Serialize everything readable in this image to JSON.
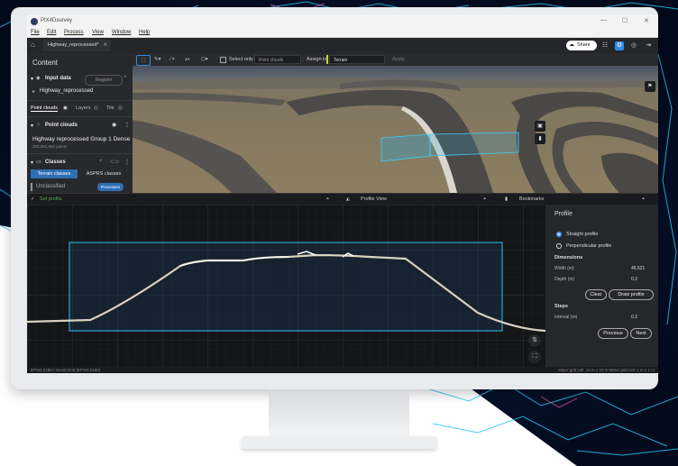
{
  "window": {
    "title": "PIX4Dsurvey",
    "minimize": "—",
    "maximize": "☐",
    "close": "✕"
  },
  "menu": [
    "File",
    "Edit",
    "Process",
    "View",
    "Window",
    "Help"
  ],
  "tabs": {
    "home_icon": "home-icon",
    "document": "Highway_reprocessed*",
    "close": "✕"
  },
  "header": {
    "share": "Share"
  },
  "toolbar": {
    "select_only": "Select only",
    "point_clouds_dropdown": "Point clouds",
    "assign_to": "Assign to",
    "terrain_dropdown": "Terrain",
    "apply": "Apply"
  },
  "content": {
    "title": "Content",
    "input_data": "Input data",
    "register": "Register",
    "input_item": "Highway_reprocessed",
    "subtabs": [
      "Point clouds",
      "Layers",
      "Tile"
    ],
    "point_clouds_heading": "Point clouds",
    "point_cloud_name": "Highway reprocessed Group 1 Dense",
    "point_count": "200,981,960 points",
    "classes_heading": "Classes",
    "class_tabs": [
      "Terrain classes",
      "ASPRS classes"
    ],
    "unclassified": "Unclassified",
    "processes_badge": "Processes"
  },
  "split": {
    "set_profile": "Set profile",
    "profile_view": "Profile View",
    "bookmarks": "Bookmarks"
  },
  "profile_panel": {
    "title": "Profile",
    "straight": "Straight profile",
    "perpendicular": "Perpendicular profile",
    "dimensions_heading": "Dimensions",
    "width_label": "Width (m)",
    "width_value": "45.521",
    "depth_label": "Depth (m)",
    "depth_value": "0.3",
    "clear": "Clear",
    "draw_profile": "Draw profile",
    "steps_heading": "Steps",
    "interval_label": "Interval (m)",
    "interval_value": "0.3",
    "previous": "Previous",
    "next": "Next"
  },
  "status": {
    "left": "EPSG:2180 / Geoid Grid (EPSG:2180)",
    "right": "Major grid cell: 10 m x 10 m  Minor grid cell: 1 m x 1 m"
  },
  "colors": {
    "accent": "#2f8ce6",
    "selection": "#2aa7d6",
    "ok_green": "#4caf50",
    "neon_lines": "#27c4f2"
  }
}
